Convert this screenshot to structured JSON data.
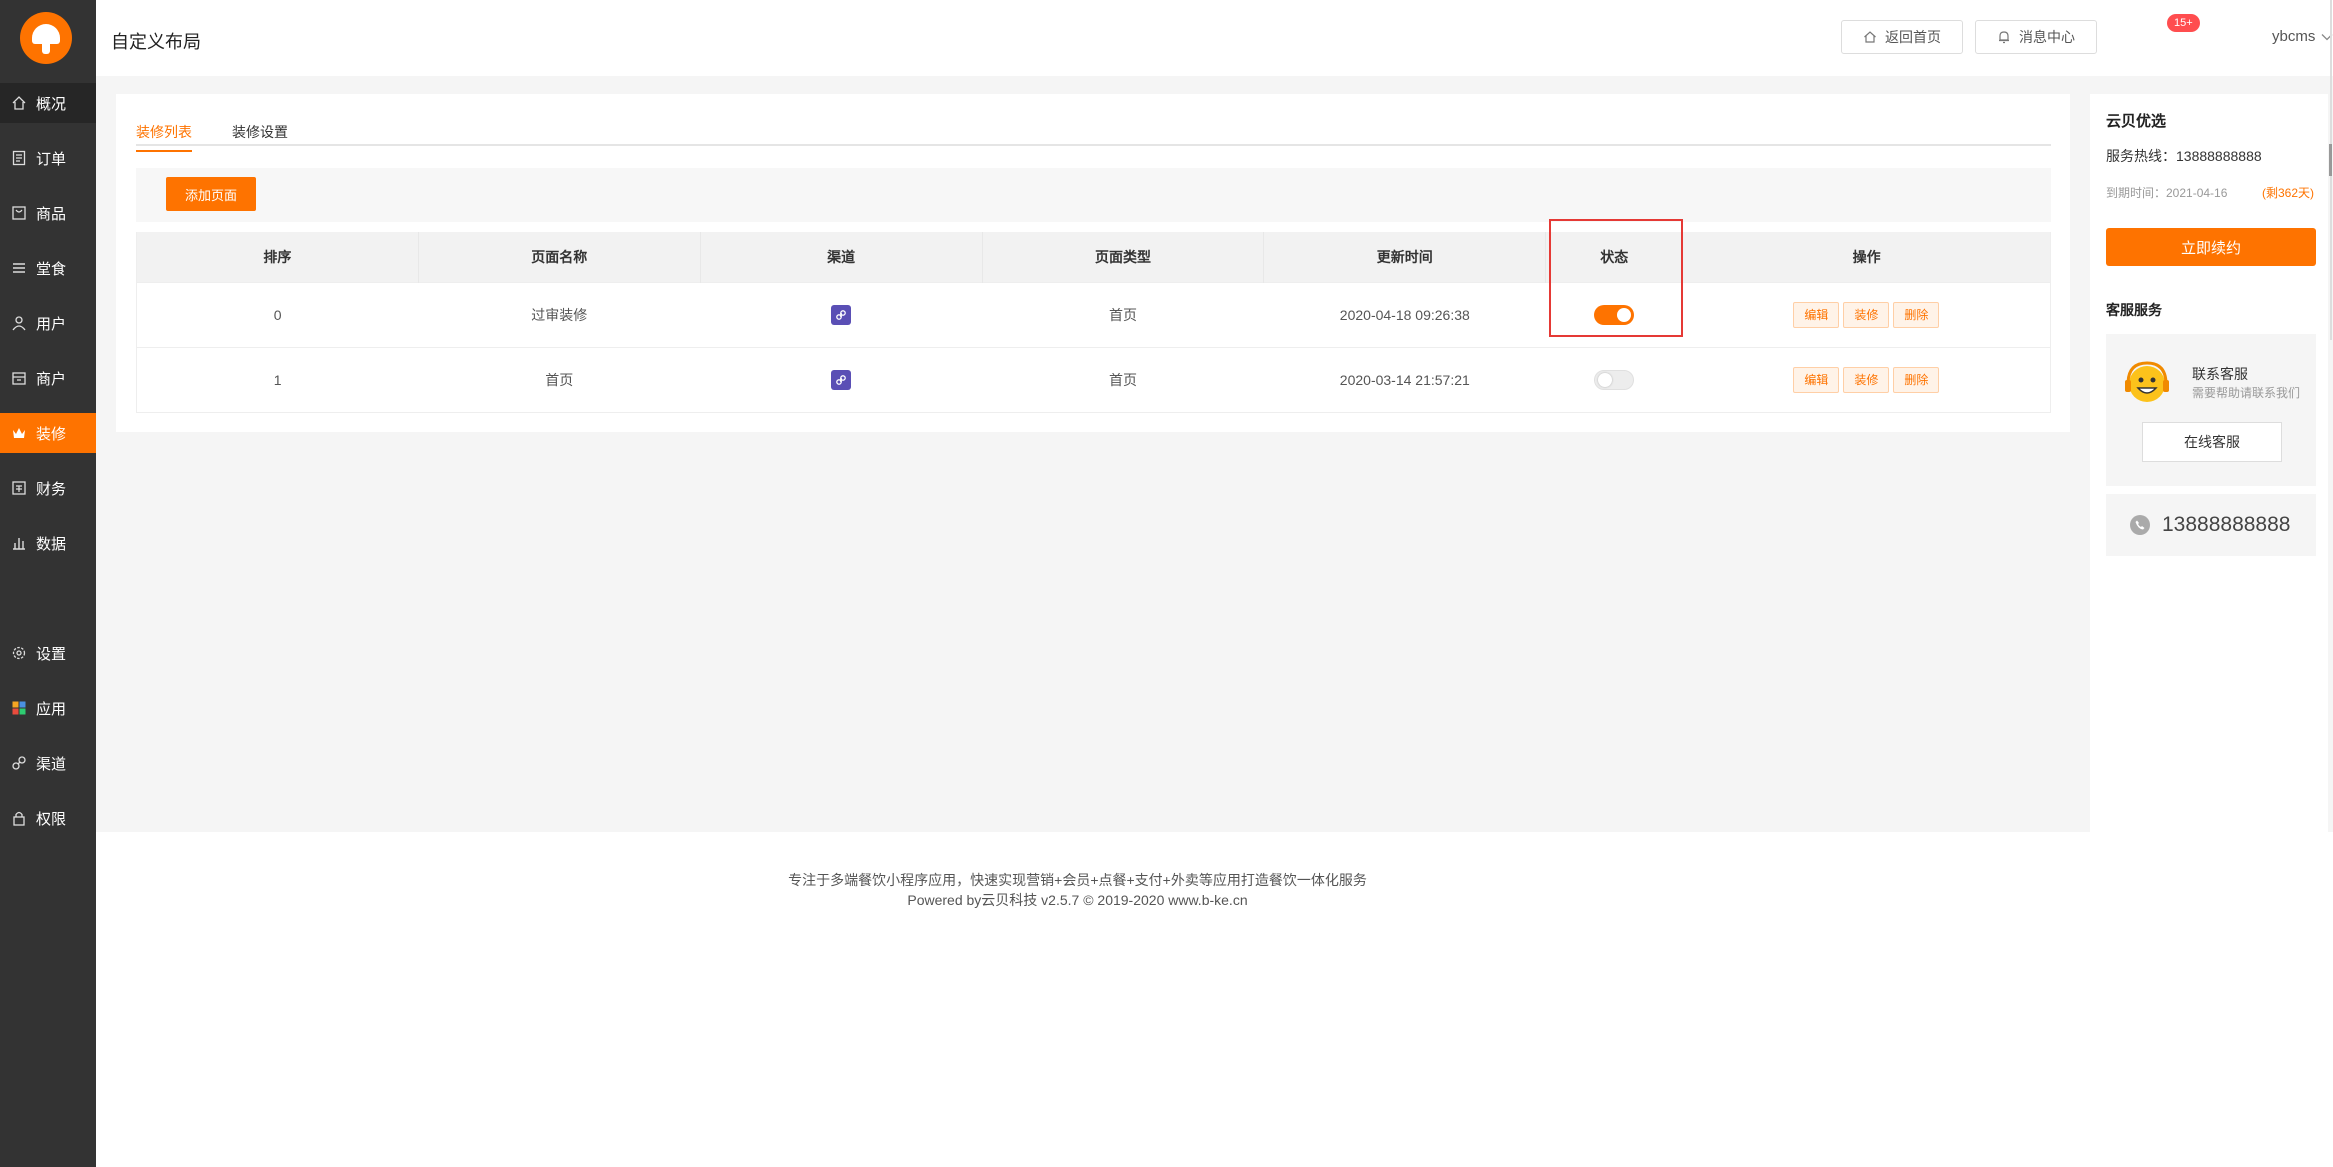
{
  "sidebar": {
    "items": [
      {
        "label": "概况",
        "icon": "home-icon"
      },
      {
        "label": "订单",
        "icon": "order-icon"
      },
      {
        "label": "商品",
        "icon": "goods-icon"
      },
      {
        "label": "堂食",
        "icon": "menu-icon"
      },
      {
        "label": "用户",
        "icon": "user-icon"
      },
      {
        "label": "商户",
        "icon": "shop-icon"
      },
      {
        "label": "装修",
        "icon": "crown-icon"
      },
      {
        "label": "财务",
        "icon": "finance-icon"
      },
      {
        "label": "数据",
        "icon": "chart-icon"
      },
      {
        "label": "设置",
        "icon": "gear-icon"
      },
      {
        "label": "应用",
        "icon": "apps-icon"
      },
      {
        "label": "渠道",
        "icon": "link-icon"
      },
      {
        "label": "权限",
        "icon": "lock-icon"
      }
    ],
    "active": "装修"
  },
  "header": {
    "title": "自定义布局",
    "home_btn": "返回首页",
    "msg_btn": "消息中心",
    "msg_badge": "15+",
    "user": "ybcms"
  },
  "tabs": [
    {
      "label": "装修列表",
      "active": true
    },
    {
      "label": "装修设置",
      "active": false
    }
  ],
  "toolbar": {
    "add_label": "添加页面"
  },
  "table": {
    "columns": [
      "排序",
      "页面名称",
      "渠道",
      "页面类型",
      "更新时间",
      "状态",
      "操作"
    ],
    "rows": [
      {
        "order": "0",
        "name": "过审装修",
        "type": "首页",
        "updated": "2020-04-18 09:26:38",
        "status_on": true
      },
      {
        "order": "1",
        "name": "首页",
        "type": "首页",
        "updated": "2020-03-14 21:57:21",
        "status_on": false
      }
    ],
    "actions": [
      "编辑",
      "装修",
      "删除"
    ]
  },
  "right_panel": {
    "title": "云贝优选",
    "hotline": "服务热线：13888888888",
    "expire": "到期时间：2021-04-16",
    "remain": "(剩362天)",
    "renew": "立即续约",
    "service_title": "客服服务",
    "service_name": "联系客服",
    "service_sub": "需要帮助请联系我们",
    "service_btn": "在线客服",
    "phone": "13888888888"
  },
  "footer": {
    "line1": "专注于多端餐饮小程序应用，快速实现营销+会员+点餐+支付+外卖等应用打造餐饮一体化服务",
    "line2": "Powered by云贝科技 v2.5.7 © 2019-2020 www.b-ke.cn"
  },
  "colors": {
    "accent": "#fe7300",
    "sidebar": "#333333",
    "highlight": "#e53935"
  }
}
